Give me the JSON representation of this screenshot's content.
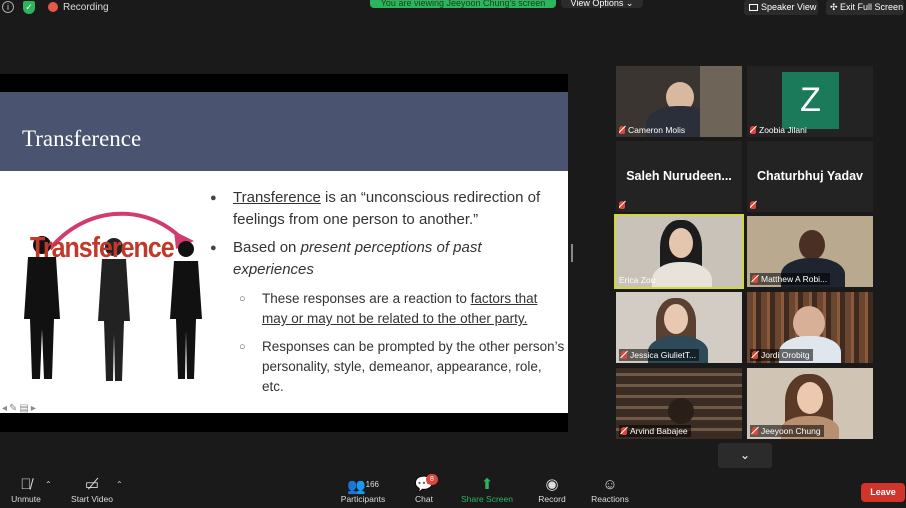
{
  "topbar": {
    "recording_label": "Recording",
    "viewing_banner": "You are viewing Jeeyoon Chung's screen",
    "view_options_label": "View Options",
    "speaker_view_label": "Speaker View",
    "exit_full_screen_label": "Exit Full Screen"
  },
  "slide": {
    "title": "Transference",
    "art_word": "Transference",
    "bullet1_term": "Transference",
    "bullet1_rest": " is an “unconscious redirection of feelings from one person to another.”",
    "bullet2_prefix": "Based on ",
    "bullet2_italic": "present perceptions of past experiences",
    "sub1_prefix": "These responses are a reaction to ",
    "sub1_underlined": "factors that may or may not be related to the other party.",
    "sub2": "Responses can be prompted by the other person’s personality, style, demeanor, appearance, role, etc."
  },
  "participants": [
    {
      "name": "Cameron Molis"
    },
    {
      "name": "Zoobia Jilani",
      "avatar_letter": "Z"
    },
    {
      "name": "Saleh Nurudeen..."
    },
    {
      "name": "Chaturbhuj Yadav"
    },
    {
      "name": "Erica Zou"
    },
    {
      "name": "Matthew A Robi..."
    },
    {
      "name": "Jessica GiulietT..."
    },
    {
      "name": "Jordi Orobitg"
    },
    {
      "name": "Arvind Babajee"
    },
    {
      "name": "Jeeyoon Chung"
    }
  ],
  "toolbar": {
    "unmute_label": "Unmute",
    "start_video_label": "Start Video",
    "participants_label": "Participants",
    "participants_count": "166",
    "chat_label": "Chat",
    "chat_badge": "8",
    "share_screen_label": "Share Screen",
    "record_label": "Record",
    "reactions_label": "Reactions",
    "leave_label": "Leave"
  },
  "colors": {
    "share_green": "#2db55d",
    "active_speaker_border": "#d2d83c",
    "leave_red": "#d1342a",
    "slide_header": "#4a5470",
    "avatar_green": "#1b7a5a"
  }
}
